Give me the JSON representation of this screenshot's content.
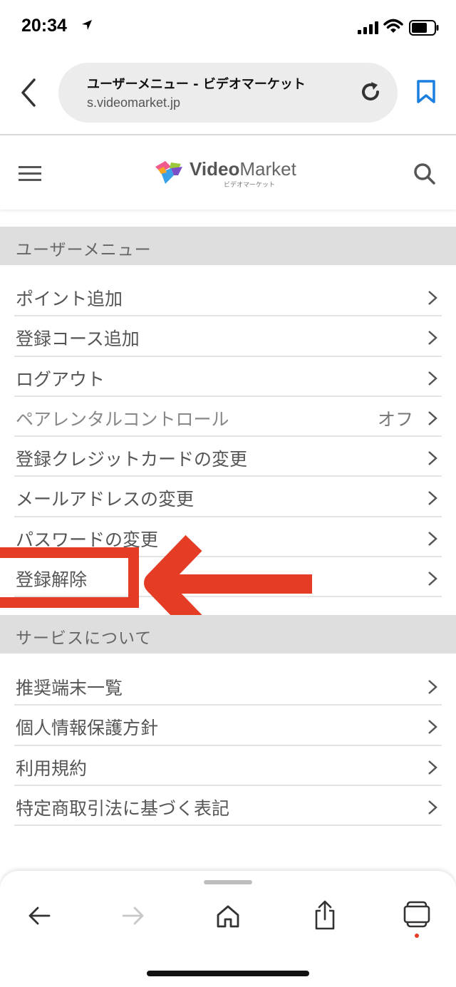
{
  "status_bar": {
    "time": "20:34"
  },
  "browser": {
    "page_title": "ユーザーメニュー - ビデオマーケット",
    "domain": "s.videomarket.jp"
  },
  "site": {
    "logo_bold": "Video",
    "logo_regular": "Market",
    "logo_sub": "ビデオマーケット"
  },
  "user_menu": {
    "header": "ユーザーメニュー",
    "items": [
      {
        "label": "ポイント追加",
        "value": ""
      },
      {
        "label": "登録コース追加",
        "value": ""
      },
      {
        "label": "ログアウト",
        "value": ""
      },
      {
        "label": "ペアレンタルコントロール",
        "value": "オフ"
      },
      {
        "label": "登録クレジットカードの変更",
        "value": ""
      },
      {
        "label": "メールアドレスの変更",
        "value": ""
      },
      {
        "label": "パスワードの変更",
        "value": ""
      },
      {
        "label": "登録解除",
        "value": ""
      }
    ]
  },
  "service_menu": {
    "header": "サービスについて",
    "items": [
      {
        "label": "推奨端末一覧"
      },
      {
        "label": "個人情報保護方針"
      },
      {
        "label": "利用規約"
      },
      {
        "label": "特定商取引法に基づく表記"
      }
    ]
  },
  "colors": {
    "accent_blue": "#1a7fe0",
    "annotation_red": "#e53c26",
    "section_bg": "#dedede",
    "notification_dot": "#e53c26"
  },
  "icons": [
    "location-arrow-icon",
    "signal-icon",
    "wifi-icon",
    "battery-icon",
    "back-chevron-icon",
    "reload-icon",
    "bookmark-icon",
    "hamburger-menu-icon",
    "search-icon",
    "chevron-right-icon",
    "back-arrow-icon",
    "forward-arrow-icon",
    "home-icon",
    "share-icon",
    "tabs-icon"
  ]
}
